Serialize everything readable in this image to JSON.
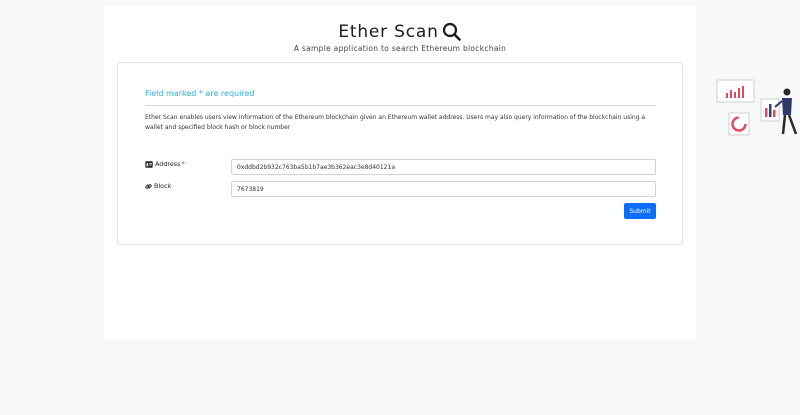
{
  "header": {
    "title": "Ether Scan",
    "subtitle": "A sample application to search Ethereum blockchain"
  },
  "form": {
    "required_note": "Field marked * are required",
    "description": "Ether Scan enables users view information of the Ethereum blockchain given an Ethereum wallet address. Users may also query information of the blockchain using a wallet and specified block hash or block number",
    "address_label": "Address",
    "required_mark": "*",
    "address_value": "0xddbd2b932c763ba5b1b7ae3b362eac3e8d40121a",
    "block_label": "Block",
    "block_value": "7673819",
    "submit_label": "Submit"
  },
  "icons": {
    "title": "search-icon",
    "address": "id-card-icon",
    "block": "link-icon"
  },
  "colors": {
    "accent": "#2ab0de",
    "primary_button": "#0d6efd",
    "required": "#e03b3b"
  }
}
